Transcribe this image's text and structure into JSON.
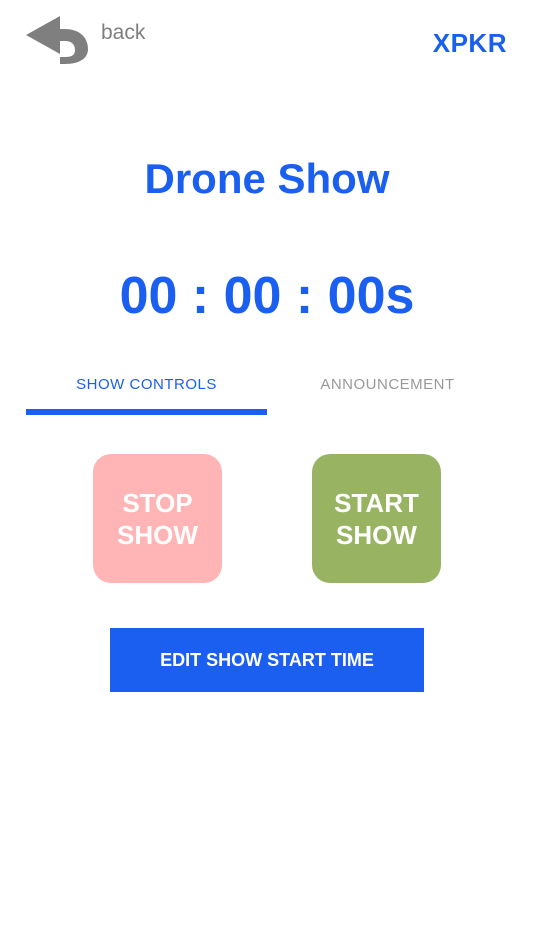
{
  "header": {
    "back_label": "back",
    "back_icon": "undo-arrow-icon",
    "brand": "XPKR"
  },
  "main": {
    "title": "Drone Show",
    "timer": "00 : 00 : 00s"
  },
  "tabs": [
    {
      "label": "SHOW CONTROLS",
      "active": true
    },
    {
      "label": "ANNOUNCEMENT",
      "active": false
    }
  ],
  "controls": {
    "stop": {
      "line1": "STOP",
      "line2": "SHOW",
      "color": "#ffb5b5"
    },
    "start": {
      "line1": "START",
      "line2": "SHOW",
      "color": "#98b462"
    },
    "edit_label": "EDIT SHOW START TIME"
  },
  "colors": {
    "accent": "#1a5ff0",
    "muted": "#7f7f7f"
  }
}
